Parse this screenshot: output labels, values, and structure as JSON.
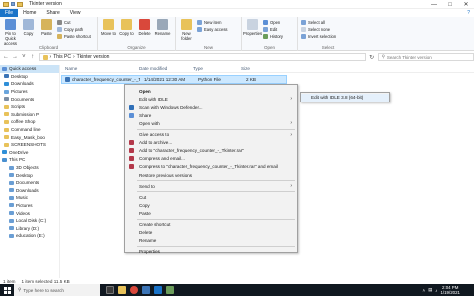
{
  "window": {
    "title": "Tkinter version"
  },
  "ribbon_tabs": [
    "File",
    "Home",
    "Share",
    "View"
  ],
  "ribbon": {
    "clipboard": {
      "pin_label": "Pin to Quick access",
      "copy_label": "Copy",
      "paste_label": "Paste",
      "cut_label": "Cut",
      "copy_path_label": "Copy path",
      "paste_shortcut_label": "Paste shortcut",
      "group_label": "Clipboard"
    },
    "organize": {
      "move_to_label": "Move to",
      "copy_to_label": "Copy to",
      "delete_label": "Delete",
      "rename_label": "Rename",
      "group_label": "Organize"
    },
    "new": {
      "new_folder_label": "New folder",
      "new_item_label": "New item",
      "easy_access_label": "Easy access",
      "group_label": "New"
    },
    "open": {
      "properties_label": "Properties",
      "open_label": "Open",
      "edit_label": "Edit",
      "history_label": "History",
      "group_label": "Open"
    },
    "select": {
      "select_all_label": "Select all",
      "select_none_label": "Select none",
      "invert_label": "Invert selection",
      "group_label": "Select"
    }
  },
  "address": {
    "path": [
      "This PC",
      "Tkinter version"
    ],
    "search_placeholder": "Search Tkinter version"
  },
  "nav": {
    "items": [
      {
        "label": "Quick access",
        "kind": "header",
        "active": true
      },
      {
        "label": "Desktop",
        "kind": "item"
      },
      {
        "label": "Downloads",
        "kind": "item"
      },
      {
        "label": "Pictures",
        "kind": "item"
      },
      {
        "label": "Documents",
        "kind": "item"
      },
      {
        "label": "Scripts",
        "kind": "item"
      },
      {
        "label": "Submission P",
        "kind": "item"
      },
      {
        "label": "coffee Shop",
        "kind": "item"
      },
      {
        "label": "Command line",
        "kind": "item"
      },
      {
        "label": "Easy_Mask_boo",
        "kind": "item"
      },
      {
        "label": "SCREENSHOTS",
        "kind": "item"
      },
      {
        "label": "OneDrive",
        "kind": "header"
      },
      {
        "label": "This PC",
        "kind": "header"
      },
      {
        "label": "3D Objects",
        "kind": "child"
      },
      {
        "label": "Desktop",
        "kind": "child"
      },
      {
        "label": "Documents",
        "kind": "child"
      },
      {
        "label": "Downloads",
        "kind": "child"
      },
      {
        "label": "Music",
        "kind": "child"
      },
      {
        "label": "Pictures",
        "kind": "child"
      },
      {
        "label": "Videos",
        "kind": "child"
      },
      {
        "label": "Local Disk (C:)",
        "kind": "child"
      },
      {
        "label": "Library (D:)",
        "kind": "child"
      },
      {
        "label": "education (E:)",
        "kind": "child"
      }
    ]
  },
  "files": {
    "columns": [
      "Name",
      "Date modified",
      "Type",
      "Size"
    ],
    "rows": [
      {
        "name": "character_frequency_counter_-_Tkinter",
        "date": "1/14/2021 12:30 AM",
        "type": "Python File",
        "size": "2 KB"
      }
    ]
  },
  "context_menu": {
    "items": [
      {
        "label": "Open",
        "bold": true
      },
      {
        "label": "Edit with IDLE",
        "submenu": true
      },
      {
        "label": "Scan with Windows Defender...",
        "icon": "defender-icon"
      },
      {
        "label": "Share",
        "icon": "share-icon"
      },
      {
        "label": "Open with",
        "submenu": true
      },
      {
        "sep": true
      },
      {
        "label": "Give access to",
        "submenu": true
      },
      {
        "label": "Add to archive...",
        "icon": "winrar-icon"
      },
      {
        "label": "Add to \"character_frequency_counter_-_Tkinter.rar\"",
        "icon": "winrar-icon"
      },
      {
        "label": "Compress and email...",
        "icon": "winrar-icon"
      },
      {
        "label": "Compress to \"character_frequency_counter_-_Tkinter.rar\" and email",
        "icon": "winrar-icon"
      },
      {
        "label": "Restore previous versions"
      },
      {
        "sep": true
      },
      {
        "label": "Send to",
        "submenu": true
      },
      {
        "sep": true
      },
      {
        "label": "Cut"
      },
      {
        "label": "Copy"
      },
      {
        "label": "Paste"
      },
      {
        "sep": true
      },
      {
        "label": "Create shortcut"
      },
      {
        "label": "Delete"
      },
      {
        "label": "Rename"
      },
      {
        "sep": true
      },
      {
        "label": "Properties"
      }
    ]
  },
  "submenu": {
    "label": "Edit with IDLE 3.8 (64-bit)"
  },
  "status": {
    "items_count": "1 item",
    "selection": "1 item selected  11.5 KB"
  },
  "taskbar": {
    "search_placeholder": "Type here to search",
    "time": "2:04 PM",
    "date": "1/19/2021"
  },
  "colors": {
    "accent": "#1a73c8",
    "selection": "#cce8ff",
    "taskbar": "#101820",
    "menu_bg": "#f2f2f2"
  }
}
